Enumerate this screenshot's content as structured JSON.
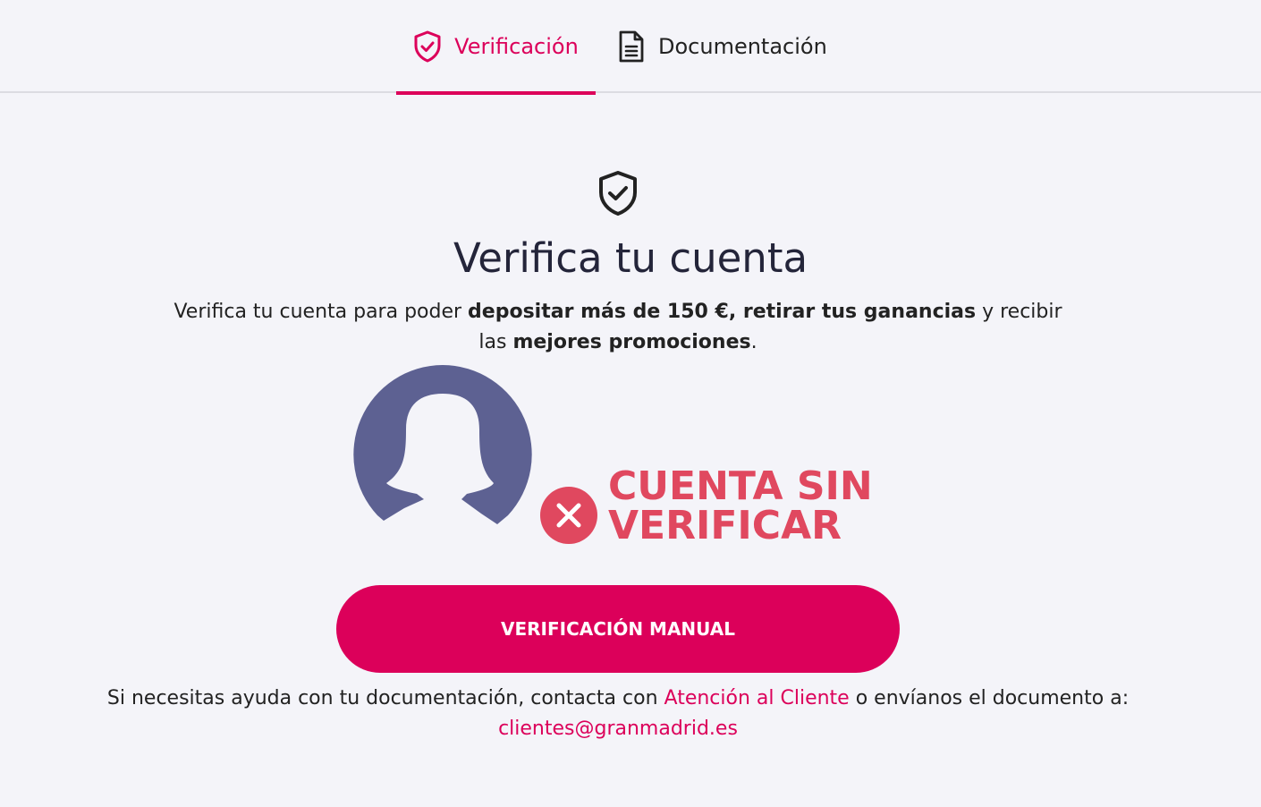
{
  "tabs": {
    "verification": {
      "label": "Verificación",
      "active": true
    },
    "documentation": {
      "label": "Documentación",
      "active": false
    }
  },
  "hero": {
    "title": "Verifica tu cuenta",
    "desc_1": "Verifica tu cuenta para poder ",
    "desc_bold_1": "depositar más de 150 €, retirar tus ganancias",
    "desc_2": " y recibir las ",
    "desc_bold_2": "mejores promociones",
    "desc_3": "."
  },
  "status": {
    "line_1": "CUENTA SIN",
    "line_2": "VERIFICAR"
  },
  "cta": {
    "label": "VERIFICACIÓN MANUAL"
  },
  "help": {
    "text_1": "Si necesitas ayuda con tu documentación, contacta con ",
    "link_support": "Atención al Cliente",
    "text_2": " o envíanos el documento a: ",
    "link_email": "clientes@granmadrid.es"
  },
  "colors": {
    "accent": "#dc005a",
    "status_red": "#e0485f",
    "avatar": "#5d6192",
    "background": "#f4f4f9"
  },
  "icons": {
    "verification_tab": "shield-check-icon",
    "documentation_tab": "document-icon",
    "hero": "shield-check-icon",
    "status": "close-circle-icon",
    "avatar": "user-silhouette-icon"
  }
}
